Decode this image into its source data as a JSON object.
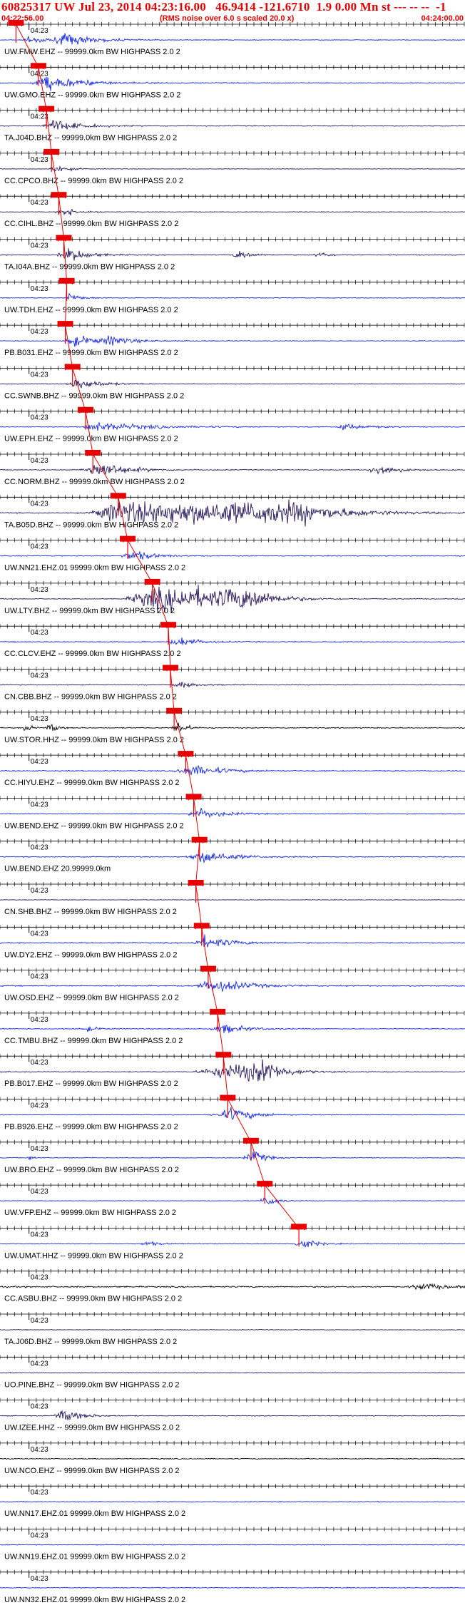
{
  "header": {
    "title": "60825317 UW Jul 23, 2014 04:23:16.00   46.9414 -121.6710  1.9 0.00 Mn st --- -- --  -1",
    "start_time": "04:22:56.00",
    "rms_note": "(RMS noise over 6.0 s scaled 20.0 x)",
    "end_time": "04:24:00.00"
  },
  "colors": {
    "blue": "#1428e6",
    "dark": "#2a1a5e",
    "black": "#000000",
    "pick": "#e60000"
  },
  "chart_data": {
    "type": "seismogram",
    "time_start": "04:22:56.00",
    "time_end": "04:24:00.00",
    "duration_s": 64,
    "minute_mark": "04:23",
    "traces": [
      {
        "label": "UW.FMW.EHZ -- 99999.0km BW  HIGHPASS  2.0  2",
        "color": "blue",
        "pick_s": 2.2,
        "events": [
          [
            4.0,
            1.0,
            2.5,
            1.8
          ],
          [
            8.5,
            1.2,
            4.0,
            2.5
          ]
        ],
        "noise": 0.25
      },
      {
        "label": "UW.GMO.EHZ -- 99999.0km BW  HIGHPASS  2.0  2",
        "color": "blue",
        "pick_s": 5.3,
        "events": [
          [
            6.0,
            2.0,
            4.5,
            3.0
          ]
        ],
        "noise": 0.35
      },
      {
        "label": "TA.J04D.BHZ -- 99999.0km BW  HIGHPASS  2.0  2",
        "color": "dark",
        "pick_s": 6.4,
        "events": [
          [
            7.0,
            1.5,
            3.5,
            2.5
          ]
        ],
        "noise": 0.25
      },
      {
        "label": "CC.CPCO.BHZ -- 99999.0km BW  HIGHPASS  2.0  2",
        "color": "dark",
        "pick_s": 7.1,
        "events": [
          [
            7.5,
            1.0,
            1.5,
            2.0
          ]
        ],
        "noise": 0.2
      },
      {
        "label": "CC.CIHL.BHZ -- 99999.0km BW  HIGHPASS  2.0  2",
        "color": "dark",
        "pick_s": 8.1,
        "events": [
          [
            8.5,
            1.0,
            2.0,
            2.0
          ]
        ],
        "noise": 0.2
      },
      {
        "label": "TA.I04A.BHZ -- 99999.0km BW  HIGHPASS  2.0  2",
        "color": "dark",
        "pick_s": 8.8,
        "events": [
          [
            9.2,
            1.5,
            2.5,
            3.0
          ],
          [
            33.0,
            1.5,
            1.5,
            2.0
          ],
          [
            44.0,
            1.0,
            1.2,
            1.5
          ]
        ],
        "noise": 0.3
      },
      {
        "label": "UW.TDH.EHZ -- 99999.0km BW  HIGHPASS  2.0  2",
        "color": "blue",
        "pick_s": 9.2,
        "events": [
          [
            9.5,
            0.8,
            1.5,
            2.0
          ]
        ],
        "noise": 0.25
      },
      {
        "label": "PB.B031.EHZ -- 99999.0km BW  HIGHPASS  2.0  2",
        "color": "blue",
        "pick_s": 9.0,
        "events": [
          [
            9.5,
            0.8,
            4.0,
            2.5
          ],
          [
            15.0,
            1.0,
            2.0,
            2.0
          ]
        ],
        "noise": 0.25
      },
      {
        "label": "CC.SWNB.BHZ -- 99999.0km BW  HIGHPASS  2.0  2",
        "color": "dark",
        "pick_s": 10.0,
        "events": [
          [
            10.5,
            1.5,
            3.0,
            2.5
          ]
        ],
        "noise": 0.25
      },
      {
        "label": "UW.EPH.EHZ -- 99999.0km BW  HIGHPASS  2.0  2",
        "color": "blue",
        "pick_s": 11.8,
        "events": [
          [
            12.0,
            0.8,
            7.5,
            2.0
          ],
          [
            47.0,
            0.5,
            3.0,
            1.5
          ]
        ],
        "noise": 0.25
      },
      {
        "label": "CC.NORM.BHZ -- 99999.0km BW  HIGHPASS  2.0  2",
        "color": "dark",
        "pick_s": 12.8,
        "events": [
          [
            13.0,
            2.0,
            3.5,
            4.0
          ],
          [
            52.0,
            1.5,
            2.0,
            3.0
          ]
        ],
        "noise": 0.3
      },
      {
        "label": "TA.B05D.BHZ -- 99999.0km BW  HIGHPASS  2.0  2",
        "color": "dark",
        "pick_s": 16.3,
        "events": [
          [
            18.0,
            6.0,
            6.0,
            10.0
          ],
          [
            36.0,
            14.0,
            6.0,
            10.0
          ]
        ],
        "noise": 0.4
      },
      {
        "label": "UW.NN21.EHZ.01 99999.0km BW  HIGHPASS  2.0  2",
        "color": "blue",
        "pick_s": 17.6,
        "events": [
          [
            18.0,
            1.5,
            2.5,
            2.5
          ]
        ],
        "noise": 0.3
      },
      {
        "label": "UW.LTY.BHZ -- 99999.0km BW  HIGHPASS  2.0  2",
        "color": "dark",
        "pick_s": 21.0,
        "events": [
          [
            23.0,
            6.0,
            5.0,
            10.0
          ],
          [
            33.0,
            4.0,
            3.0,
            6.0
          ]
        ],
        "noise": 0.3
      },
      {
        "label": "CC.CLCV.EHZ -- 99999.0km BW  HIGHPASS  2.0  2",
        "color": "blue",
        "pick_s": 23.2,
        "events": [
          [
            24.5,
            1.5,
            2.5,
            2.0
          ]
        ],
        "noise": 0.35
      },
      {
        "label": "CN.CBB.BHZ -- 99999.0km BW  HIGHPASS  2.0  2",
        "color": "dark",
        "pick_s": 23.5,
        "events": [
          [
            24.5,
            1.0,
            2.0,
            1.5
          ]
        ],
        "noise": 0.25
      },
      {
        "label": "UW.STOR.HHZ -- 99999.0km BW  HIGHPASS  2.0  2",
        "color": "black",
        "pick_s": 24.0,
        "events": [
          [
            3.5,
            0.6,
            0.8,
            1.5
          ],
          [
            7.0,
            0.8,
            0.8,
            2.0
          ],
          [
            24.5,
            1.0,
            1.0,
            3.0
          ]
        ],
        "noise": 0.35
      },
      {
        "label": "CC.HIYU.EHZ -- 99999.0km BW  HIGHPASS  2.0  2",
        "color": "blue",
        "pick_s": 25.6,
        "events": [
          [
            26.0,
            2.5,
            4.0,
            2.5
          ]
        ],
        "noise": 0.35
      },
      {
        "label": "UW.BEND.EHZ -- 99999.0km BW  HIGHPASS  2.0  2",
        "color": "blue",
        "pick_s": 26.7,
        "events": [
          [
            27.0,
            1.5,
            3.0,
            2.5
          ]
        ],
        "noise": 0.3
      },
      {
        "label": "UW.BEND.EHZ 20.99999.0km",
        "color": "blue",
        "pick_s": 27.5,
        "events": [
          [
            27.8,
            2.5,
            3.5,
            3.0
          ]
        ],
        "noise": 0.35
      },
      {
        "label": "CN.SHB.BHZ -- 99999.0km BW  HIGHPASS  2.0  2",
        "color": "dark",
        "pick_s": 27.0,
        "events": [],
        "noise": 0.2
      },
      {
        "label": "UW.DY2.EHZ -- 99999.0km BW  HIGHPASS  2.0  2",
        "color": "blue",
        "pick_s": 27.8,
        "events": [
          [
            28.0,
            2.0,
            3.5,
            2.5
          ]
        ],
        "noise": 0.4
      },
      {
        "label": "UW.OSD.EHZ -- 99999.0km BW  HIGHPASS  2.0  2",
        "color": "blue",
        "pick_s": 28.7,
        "events": [
          [
            29.0,
            2.5,
            4.0,
            3.0
          ]
        ],
        "noise": 0.4
      },
      {
        "label": "CC.TMBU.BHZ -- 99999.0km BW  HIGHPASS  2.0  2",
        "color": "blue",
        "pick_s": 30.0,
        "events": [
          [
            12.0,
            1.5,
            1.5,
            1.0
          ],
          [
            30.5,
            2.0,
            3.0,
            2.0
          ]
        ],
        "noise": 0.3
      },
      {
        "label": "PB.B017.EHZ -- 99999.0km BW  HIGHPASS  2.0  2",
        "color": "dark",
        "pick_s": 30.8,
        "events": [
          [
            31.0,
            4.5,
            3.0,
            4.0
          ],
          [
            36.0,
            4.0,
            2.5,
            5.5
          ]
        ],
        "noise": 0.3
      },
      {
        "label": "PB.B926.EHZ -- 99999.0km BW  HIGHPASS  2.0  2",
        "color": "blue",
        "pick_s": 31.4,
        "events": [
          [
            31.6,
            3.0,
            3.0,
            3.0
          ]
        ],
        "noise": 0.2
      },
      {
        "label": "UW.BRO.EHZ -- 99999.0km BW  HIGHPASS  2.0  2",
        "color": "blue",
        "pick_s": 34.6,
        "events": [
          [
            4.0,
            0.5,
            0.5,
            1.2
          ],
          [
            34.8,
            1.5,
            1.5,
            3.0
          ]
        ],
        "noise": 0.25
      },
      {
        "label": "UW.VFP.EHZ -- 99999.0km BW  HIGHPASS  2.0  2",
        "color": "blue",
        "pick_s": 36.5,
        "events": [
          [
            36.8,
            1.2,
            1.2,
            3.0
          ]
        ],
        "noise": 0.2
      },
      {
        "label": "UW.UMAT.HHZ -- 99999.0km BW  HIGHPASS  2.0  2",
        "color": "blue",
        "pick_s": 41.2,
        "events": [
          [
            20.0,
            0.8,
            1.5,
            1.2
          ],
          [
            41.5,
            1.0,
            1.5,
            3.0
          ]
        ],
        "noise": 0.25
      },
      {
        "label": "CC.ASBU.BHZ -- 99999.0km BW  HIGHPASS  2.0  2",
        "color": "black",
        "pick_s": null,
        "events": [
          [
            58.0,
            2.0,
            3.0,
            1.5
          ]
        ],
        "noise": 0.5
      },
      {
        "label": "TA.J06D.BHZ -- 99999.0km BW  HIGHPASS  2.0  2",
        "color": "dark",
        "pick_s": null,
        "events": [],
        "noise": 0.25
      },
      {
        "label": "UO.PINE.BHZ -- 99999.0km BW  HIGHPASS  2.0  2",
        "color": "dark",
        "pick_s": null,
        "events": [],
        "noise": 0.25
      },
      {
        "label": "UW.IZEE.HHZ -- 99999.0km BW  HIGHPASS  2.0  2",
        "color": "dark",
        "pick_s": null,
        "events": [
          [
            8.5,
            1.5,
            2.5,
            2.5
          ]
        ],
        "noise": 0.3
      },
      {
        "label": "UW.NCO.EHZ -- 99999.0km BW  HIGHPASS  2.0  2",
        "color": "black",
        "pick_s": null,
        "events": [],
        "noise": 0.3
      },
      {
        "label": "UW.NN17.EHZ.01 99999.0km BW  HIGHPASS  2.0  2",
        "color": "blue",
        "pick_s": null,
        "events": [],
        "noise": 0.3
      },
      {
        "label": "UW.NN19.EHZ.01 99999.0km BW  HIGHPASS  2.0  2",
        "color": "blue",
        "pick_s": null,
        "events": [],
        "noise": 0.3
      },
      {
        "label": "UW.NN32.EHZ.01 99999.0km BW  HIGHPASS  2.0  2",
        "color": "blue",
        "pick_s": null,
        "events": [],
        "noise": 0.3
      }
    ]
  }
}
